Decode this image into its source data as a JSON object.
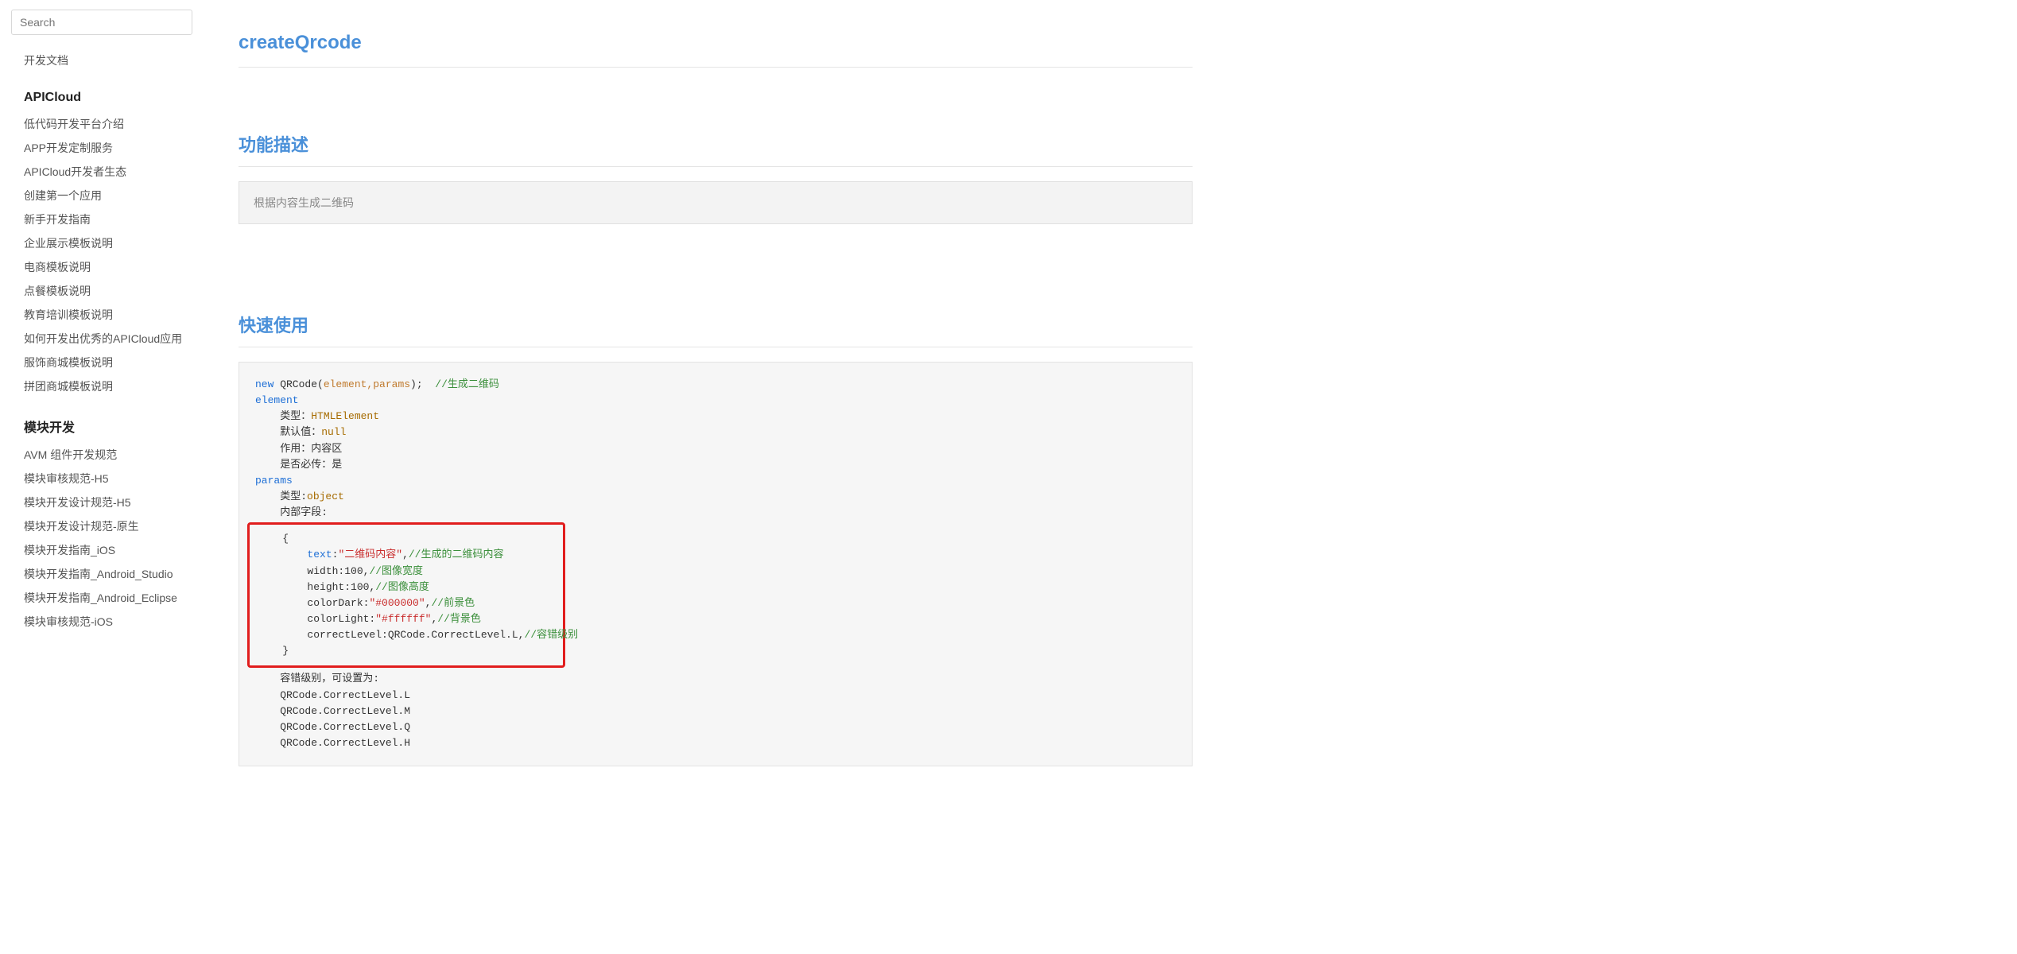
{
  "search": {
    "placeholder": "Search"
  },
  "sidebar": {
    "top_item": "开发文档",
    "section1": {
      "heading": "APICloud",
      "items": [
        "低代码开发平台介绍",
        "APP开发定制服务",
        "APICloud开发者生态",
        "创建第一个应用",
        "新手开发指南",
        "企业展示模板说明",
        "电商模板说明",
        "点餐模板说明",
        "教育培训模板说明",
        "如何开发出优秀的APICloud应用",
        "服饰商城模板说明",
        "拼团商城模板说明"
      ]
    },
    "section2": {
      "heading": "模块开发",
      "items": [
        "AVM 组件开发规范",
        "模块审核规范-H5",
        "模块开发设计规范-H5",
        "模块开发设计规范-原生",
        "模块开发指南_iOS",
        "模块开发指南_Android_Studio",
        "模块开发指南_Android_Eclipse",
        "模块审核规范-iOS"
      ]
    }
  },
  "main": {
    "title": "createQrcode",
    "section_desc_title": "功能描述",
    "description": "根据内容生成二维码",
    "section_usage_title": "快速使用",
    "code": {
      "line1_kw": "new",
      "line1_func": " QRCode(",
      "line1_params": "element,params",
      "line1_end": ");  ",
      "line1_cmt": "//生成二维码",
      "element_key": "element",
      "element_type_label": "    类型：",
      "element_type_val": "HTMLElement",
      "element_default_label": "    默认值：",
      "element_default_val": "null",
      "element_role": "    作用：内容区",
      "element_required": "    是否必传：是",
      "params_key": "params",
      "params_type_label": "    类型:",
      "params_type_val": "object",
      "params_fields": "    内部字段:",
      "brace_open": "    {",
      "f_text_key": "text",
      "f_text_sep": ":",
      "f_text_val": "\"二维码内容\"",
      "f_text_comma": ",",
      "f_text_cmt": "//生成的二维码内容",
      "f_width": "        width:100,",
      "f_width_cmt": "//图像宽度",
      "f_height": "        height:100,",
      "f_height_cmt": "//图像高度",
      "f_dark_pre": "        colorDark:",
      "f_dark_val": "\"#000000\"",
      "f_dark_comma": ",",
      "f_dark_cmt": "//前景色",
      "f_light_pre": "        colorLight:",
      "f_light_val": "\"#ffffff\"",
      "f_light_comma": ",",
      "f_light_cmt": "//背景色",
      "f_level_pre": "        correctLevel:QRCode.CorrectLevel.L,",
      "f_level_cmt": "//容错级别",
      "brace_close": "    }",
      "lvl_note": "    容错级别，可设置为:",
      "lvl_l": "    QRCode.CorrectLevel.L",
      "lvl_m": "    QRCode.CorrectLevel.M",
      "lvl_q": "    QRCode.CorrectLevel.Q",
      "lvl_h": "    QRCode.CorrectLevel.H"
    }
  },
  "watermark": ""
}
